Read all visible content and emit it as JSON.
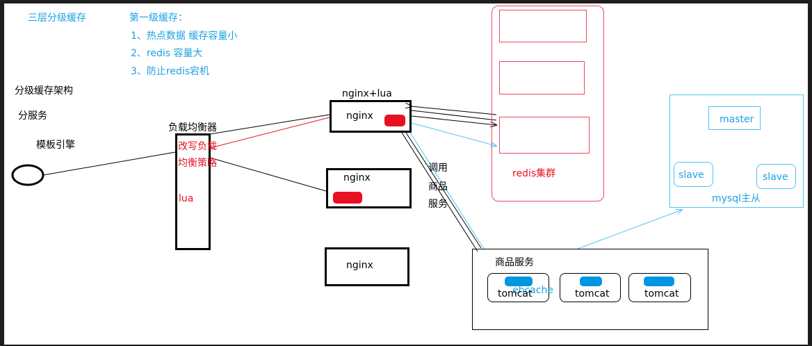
{
  "notes": {
    "title": "三层分级缓存",
    "level1_heading": "第一级缓存：",
    "level1_items": [
      "1、热点数据  缓存容量小",
      "2、redis 容量大",
      "3、防止redis宕机"
    ]
  },
  "left_labels": {
    "architecture": "分级缓存架构",
    "sub_service": "分服务",
    "template_engine": "模板引擎"
  },
  "load_balancer": {
    "title": "负载均衡器",
    "rewrite_line1": "改写负载",
    "rewrite_line2": "均衡策略",
    "lua": "lua"
  },
  "nginx_cluster": {
    "group_label": "nginx+lua",
    "nodes": [
      "nginx",
      "nginx",
      "nginx"
    ]
  },
  "call_label": [
    "调用",
    "商品",
    "服务"
  ],
  "redis": {
    "label": "redis集群"
  },
  "mysql": {
    "master": "master",
    "slave1": "slave",
    "slave2": "slave",
    "label": "mysql主从"
  },
  "product_service": {
    "title": "商品服务",
    "cache_label": "ehcache",
    "nodes": [
      "tomcat",
      "tomcat",
      "tomcat"
    ]
  },
  "colors": {
    "blue": "#1ba1e2",
    "red": "#e81123",
    "pink": "#e84a5f",
    "light_blue": "#4fc3f7",
    "pill_blue": "#0096e0"
  }
}
